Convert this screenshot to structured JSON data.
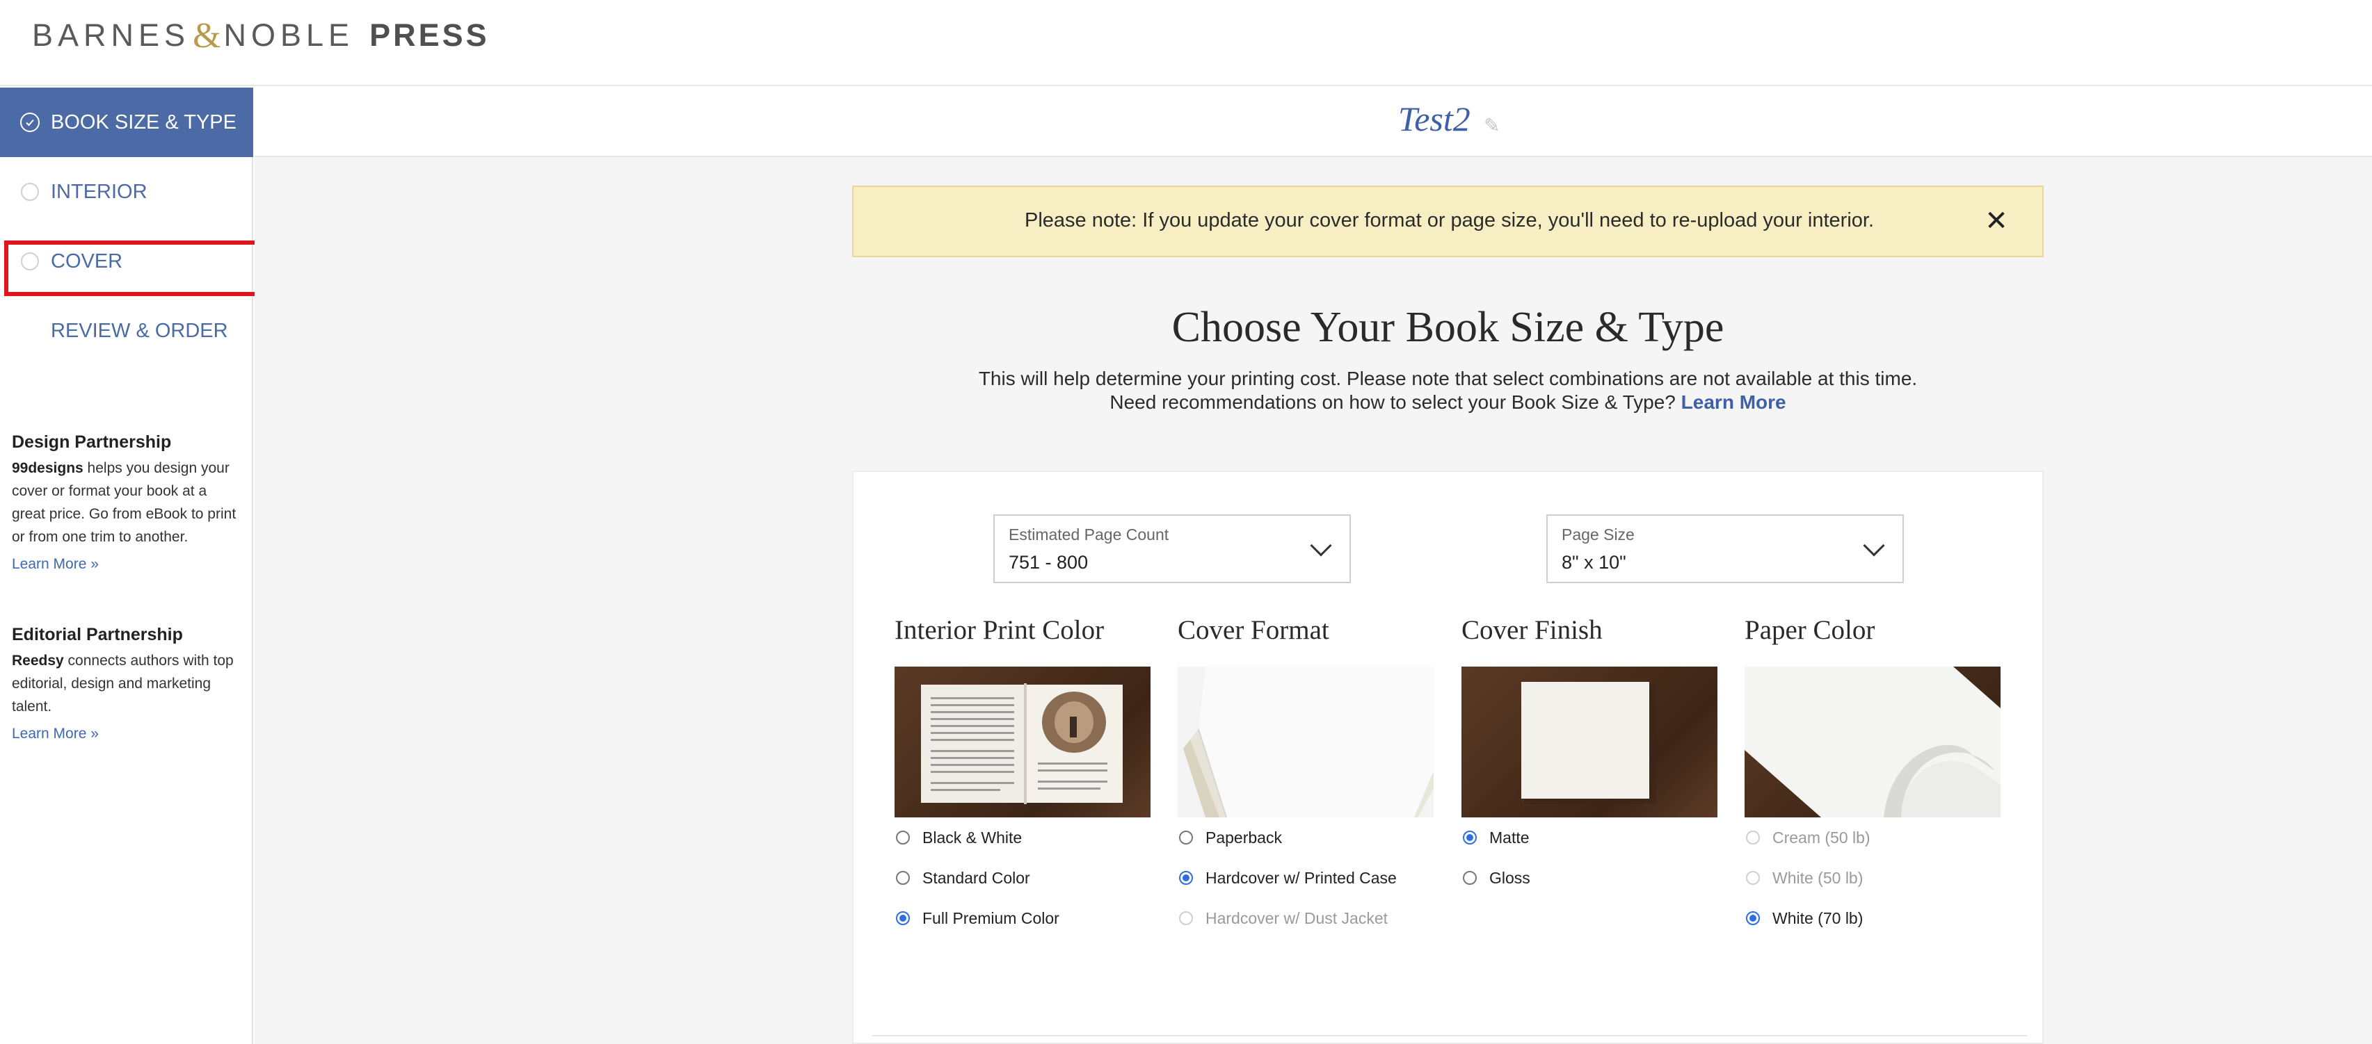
{
  "brand": {
    "part1": "BARNES",
    "amp": "&",
    "part2": "NOBLE",
    "part3": "PRESS",
    "accent": "#b89b4a"
  },
  "sidebar": {
    "items": [
      {
        "label": "BOOK SIZE & TYPE",
        "state": "complete"
      },
      {
        "label": "INTERIOR",
        "state": "pending"
      },
      {
        "label": "COVER",
        "state": "pending"
      },
      {
        "label": "REVIEW & ORDER",
        "state": "none"
      }
    ],
    "promos": [
      {
        "title": "Design Partnership",
        "brand": "99designs",
        "text": " helps you design your cover or format your book at a great price. Go from eBook to print or from one trim to another.",
        "link": "Learn More »"
      },
      {
        "title": "Editorial Partnership",
        "brand": "Reedsy",
        "text": " connects authors with top editorial, design and marketing talent.",
        "link": "Learn More »"
      }
    ]
  },
  "main": {
    "book_title": "Test2",
    "notice": "Please note: If you update your cover format or page size, you'll need to re-upload your interior.",
    "heading": "Choose Your Book Size & Type",
    "sub1": "This will help determine your printing cost. Please note that select combinations are not available at this time.",
    "sub2": "Need recommendations on how to select your Book Size & Type?",
    "sub2_link": "Learn More",
    "page_count": {
      "label": "Estimated Page Count",
      "value": "751 - 800"
    },
    "page_size": {
      "label": "Page Size",
      "value": "8\" x 10\""
    },
    "columns": [
      {
        "title": "Interior Print Color",
        "options": [
          {
            "label": "Black & White",
            "state": "normal"
          },
          {
            "label": "Standard Color",
            "state": "normal"
          },
          {
            "label": "Full Premium Color",
            "state": "selected"
          }
        ]
      },
      {
        "title": "Cover Format",
        "options": [
          {
            "label": "Paperback",
            "state": "normal"
          },
          {
            "label": "Hardcover w/ Printed Case",
            "state": "selected"
          },
          {
            "label": "Hardcover w/ Dust Jacket",
            "state": "disabled"
          }
        ]
      },
      {
        "title": "Cover Finish",
        "options": [
          {
            "label": "Matte",
            "state": "selected"
          },
          {
            "label": "Gloss",
            "state": "normal"
          }
        ]
      },
      {
        "title": "Paper Color",
        "options": [
          {
            "label": "Cream (50 lb)",
            "state": "disabled"
          },
          {
            "label": "White (50 lb)",
            "state": "disabled"
          },
          {
            "label": "White (70 lb)",
            "state": "selected"
          }
        ]
      }
    ]
  },
  "colors": {
    "nav_active": "#4c6aa6",
    "link": "#3e60a8",
    "notice_bg": "#f8eec3",
    "radio_selected": "#2f6ee0",
    "highlight": "#e0141c"
  }
}
